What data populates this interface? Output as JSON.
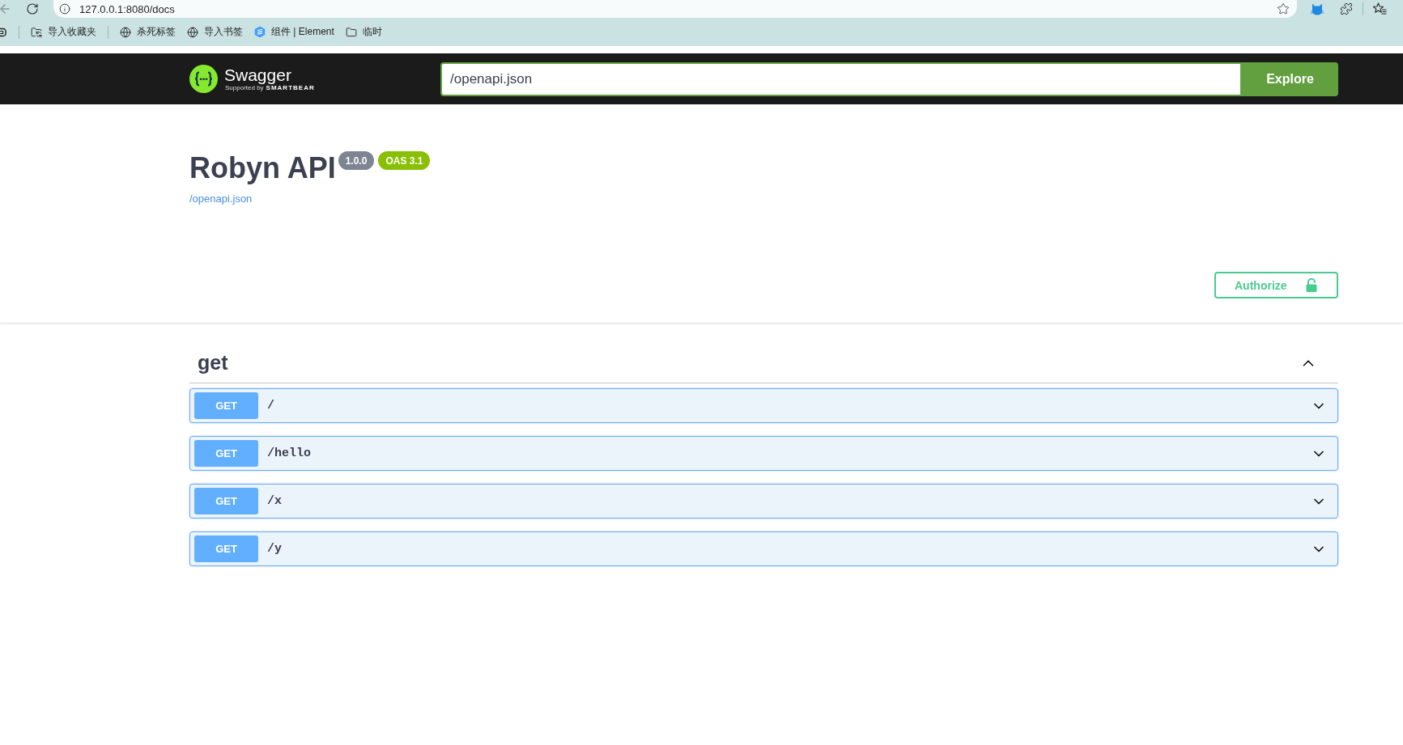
{
  "browser": {
    "url": "127.0.0.1:8080/docs",
    "bookmark_groups": [
      {
        "items": [
          {
            "label": "导入收藏夹",
            "kind": "import"
          }
        ]
      },
      {
        "items": [
          {
            "label": "杀死标签",
            "kind": "web"
          },
          {
            "label": "导入书签",
            "kind": "web"
          },
          {
            "label": "组件 | Element",
            "kind": "app"
          },
          {
            "label": "临时",
            "kind": "folder"
          }
        ]
      }
    ]
  },
  "topbar": {
    "logo": {
      "name": "Swagger",
      "tagline": "Supported by",
      "brand": "SMARTBEAR"
    },
    "url_field": {
      "value": "/openapi.json"
    },
    "explore_button": "Explore"
  },
  "info": {
    "title": "Robyn API",
    "version": "1.0.0",
    "spec_version": "OAS 3.1",
    "spec_link": "/openapi.json"
  },
  "authorize_button": "Authorize",
  "tags": [
    {
      "name": "get",
      "expanded": true,
      "operations": [
        {
          "method": "GET",
          "path": "/",
          "expanded": false
        },
        {
          "method": "GET",
          "path": "/hello",
          "expanded": false
        },
        {
          "method": "GET",
          "path": "/x",
          "expanded": false
        },
        {
          "method": "GET",
          "path": "/y",
          "expanded": false
        }
      ]
    }
  ]
}
